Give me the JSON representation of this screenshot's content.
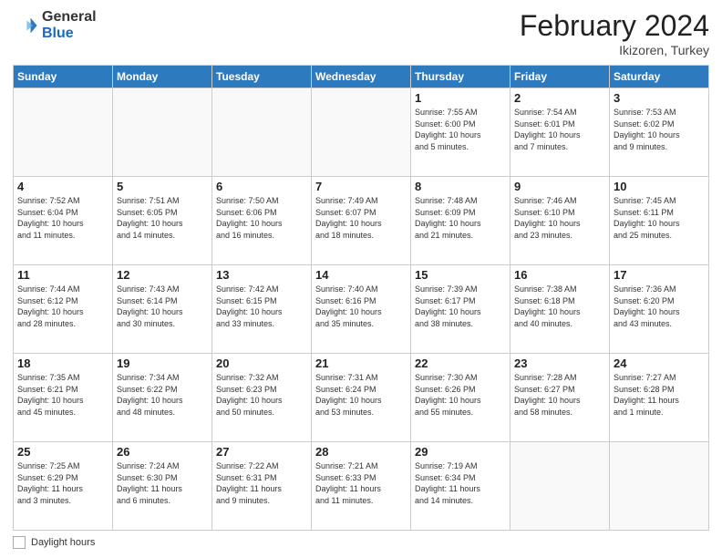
{
  "header": {
    "logo_general": "General",
    "logo_blue": "Blue",
    "month_title": "February 2024",
    "location": "Ikizoren, Turkey"
  },
  "weekdays": [
    "Sunday",
    "Monday",
    "Tuesday",
    "Wednesday",
    "Thursday",
    "Friday",
    "Saturday"
  ],
  "footer": {
    "daylight_label": "Daylight hours"
  },
  "weeks": [
    [
      {
        "day": "",
        "info": ""
      },
      {
        "day": "",
        "info": ""
      },
      {
        "day": "",
        "info": ""
      },
      {
        "day": "",
        "info": ""
      },
      {
        "day": "1",
        "info": "Sunrise: 7:55 AM\nSunset: 6:00 PM\nDaylight: 10 hours\nand 5 minutes."
      },
      {
        "day": "2",
        "info": "Sunrise: 7:54 AM\nSunset: 6:01 PM\nDaylight: 10 hours\nand 7 minutes."
      },
      {
        "day": "3",
        "info": "Sunrise: 7:53 AM\nSunset: 6:02 PM\nDaylight: 10 hours\nand 9 minutes."
      }
    ],
    [
      {
        "day": "4",
        "info": "Sunrise: 7:52 AM\nSunset: 6:04 PM\nDaylight: 10 hours\nand 11 minutes."
      },
      {
        "day": "5",
        "info": "Sunrise: 7:51 AM\nSunset: 6:05 PM\nDaylight: 10 hours\nand 14 minutes."
      },
      {
        "day": "6",
        "info": "Sunrise: 7:50 AM\nSunset: 6:06 PM\nDaylight: 10 hours\nand 16 minutes."
      },
      {
        "day": "7",
        "info": "Sunrise: 7:49 AM\nSunset: 6:07 PM\nDaylight: 10 hours\nand 18 minutes."
      },
      {
        "day": "8",
        "info": "Sunrise: 7:48 AM\nSunset: 6:09 PM\nDaylight: 10 hours\nand 21 minutes."
      },
      {
        "day": "9",
        "info": "Sunrise: 7:46 AM\nSunset: 6:10 PM\nDaylight: 10 hours\nand 23 minutes."
      },
      {
        "day": "10",
        "info": "Sunrise: 7:45 AM\nSunset: 6:11 PM\nDaylight: 10 hours\nand 25 minutes."
      }
    ],
    [
      {
        "day": "11",
        "info": "Sunrise: 7:44 AM\nSunset: 6:12 PM\nDaylight: 10 hours\nand 28 minutes."
      },
      {
        "day": "12",
        "info": "Sunrise: 7:43 AM\nSunset: 6:14 PM\nDaylight: 10 hours\nand 30 minutes."
      },
      {
        "day": "13",
        "info": "Sunrise: 7:42 AM\nSunset: 6:15 PM\nDaylight: 10 hours\nand 33 minutes."
      },
      {
        "day": "14",
        "info": "Sunrise: 7:40 AM\nSunset: 6:16 PM\nDaylight: 10 hours\nand 35 minutes."
      },
      {
        "day": "15",
        "info": "Sunrise: 7:39 AM\nSunset: 6:17 PM\nDaylight: 10 hours\nand 38 minutes."
      },
      {
        "day": "16",
        "info": "Sunrise: 7:38 AM\nSunset: 6:18 PM\nDaylight: 10 hours\nand 40 minutes."
      },
      {
        "day": "17",
        "info": "Sunrise: 7:36 AM\nSunset: 6:20 PM\nDaylight: 10 hours\nand 43 minutes."
      }
    ],
    [
      {
        "day": "18",
        "info": "Sunrise: 7:35 AM\nSunset: 6:21 PM\nDaylight: 10 hours\nand 45 minutes."
      },
      {
        "day": "19",
        "info": "Sunrise: 7:34 AM\nSunset: 6:22 PM\nDaylight: 10 hours\nand 48 minutes."
      },
      {
        "day": "20",
        "info": "Sunrise: 7:32 AM\nSunset: 6:23 PM\nDaylight: 10 hours\nand 50 minutes."
      },
      {
        "day": "21",
        "info": "Sunrise: 7:31 AM\nSunset: 6:24 PM\nDaylight: 10 hours\nand 53 minutes."
      },
      {
        "day": "22",
        "info": "Sunrise: 7:30 AM\nSunset: 6:26 PM\nDaylight: 10 hours\nand 55 minutes."
      },
      {
        "day": "23",
        "info": "Sunrise: 7:28 AM\nSunset: 6:27 PM\nDaylight: 10 hours\nand 58 minutes."
      },
      {
        "day": "24",
        "info": "Sunrise: 7:27 AM\nSunset: 6:28 PM\nDaylight: 11 hours\nand 1 minute."
      }
    ],
    [
      {
        "day": "25",
        "info": "Sunrise: 7:25 AM\nSunset: 6:29 PM\nDaylight: 11 hours\nand 3 minutes."
      },
      {
        "day": "26",
        "info": "Sunrise: 7:24 AM\nSunset: 6:30 PM\nDaylight: 11 hours\nand 6 minutes."
      },
      {
        "day": "27",
        "info": "Sunrise: 7:22 AM\nSunset: 6:31 PM\nDaylight: 11 hours\nand 9 minutes."
      },
      {
        "day": "28",
        "info": "Sunrise: 7:21 AM\nSunset: 6:33 PM\nDaylight: 11 hours\nand 11 minutes."
      },
      {
        "day": "29",
        "info": "Sunrise: 7:19 AM\nSunset: 6:34 PM\nDaylight: 11 hours\nand 14 minutes."
      },
      {
        "day": "",
        "info": ""
      },
      {
        "day": "",
        "info": ""
      }
    ]
  ]
}
